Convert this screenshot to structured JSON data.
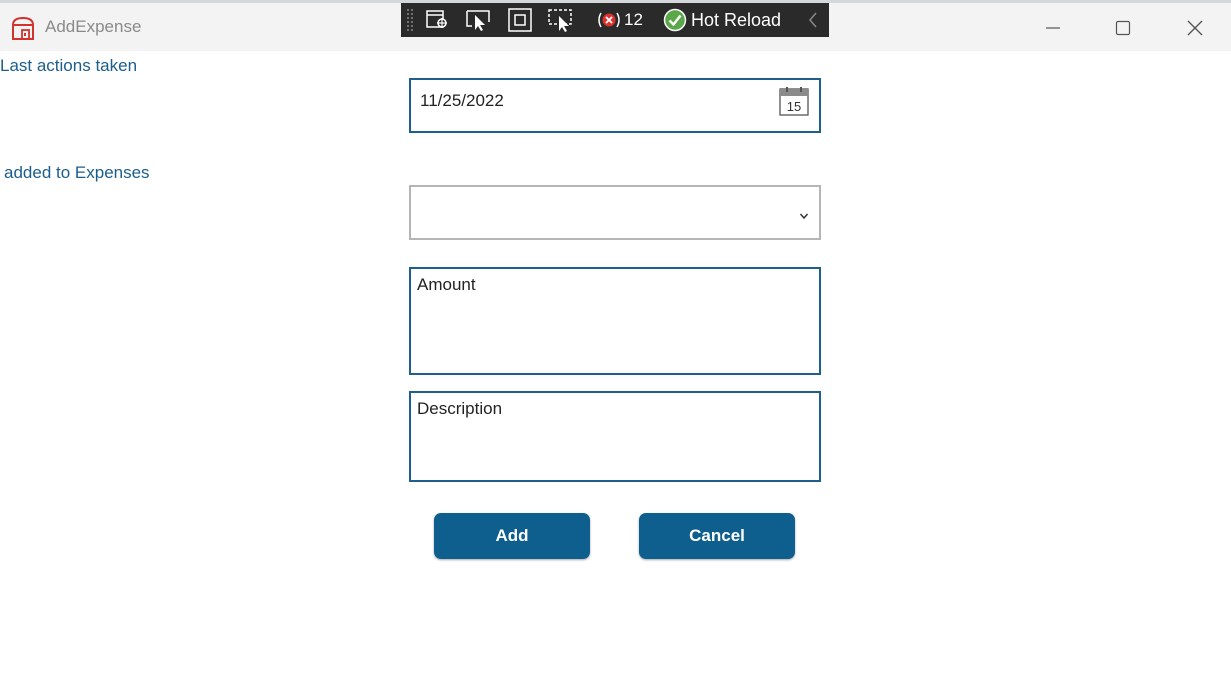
{
  "window": {
    "title": "AddExpense",
    "app_icon": "app-store-icon",
    "controls": [
      "minimize-icon",
      "maximize-icon",
      "close-icon"
    ]
  },
  "debug_toolbar": {
    "tools": [
      "live-visual-tree-icon",
      "select-element-icon",
      "display-layout-adorners-icon",
      "track-focus-icon"
    ],
    "error_count": "12",
    "hot_reload_label": "Hot Reload"
  },
  "status": {
    "last_actions_title": "Last actions taken",
    "last_action_text": " added to Expenses"
  },
  "form": {
    "date_value": "11/25/2022",
    "calendar_day": "15",
    "category_value": "",
    "amount_placeholder": "Amount",
    "description_placeholder": "Description",
    "add_label": "Add",
    "cancel_label": "Cancel"
  },
  "colors": {
    "accent": "#1e5f8c",
    "button_bg": "#0f5f8e",
    "link_text": "#1b5e8c"
  }
}
